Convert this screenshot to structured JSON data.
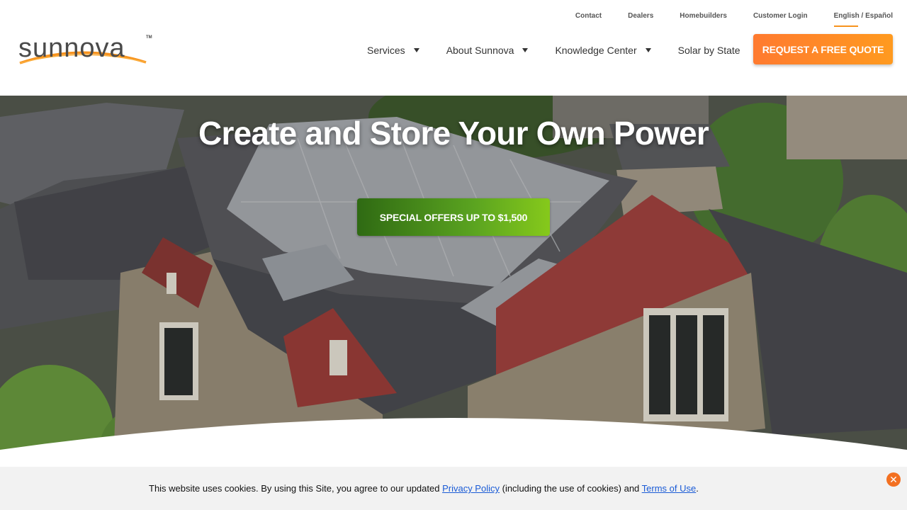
{
  "header": {
    "logo_text": "sunnova",
    "logo_tm": "TM",
    "utility_nav": [
      "Contact",
      "Dealers",
      "Homebuilders",
      "Customer Login"
    ],
    "language": {
      "english": "English",
      "separator": " / ",
      "spanish": "Español"
    },
    "main_nav": [
      "Services",
      "About Sunnova",
      "Knowledge Center",
      "Solar by State"
    ],
    "quote_button": "REQUEST A FREE QUOTE"
  },
  "hero": {
    "title": "Create and Store Your Own Power",
    "offer_button": "SPECIAL OFFERS UP TO $1,500"
  },
  "cookie": {
    "text_before": "This website uses cookies. By using this Site, you agree to our updated ",
    "privacy_link": "Privacy Policy",
    "text_middle": " (including the use of cookies) and ",
    "terms_link": "Terms of Use",
    "text_after": ".",
    "close_icon": "close-icon"
  },
  "colors": {
    "brand_orange": "#f7931e",
    "quote_button": "#ff8a26",
    "offer_green": "#5aa320",
    "link_blue": "#1a5bd6"
  }
}
